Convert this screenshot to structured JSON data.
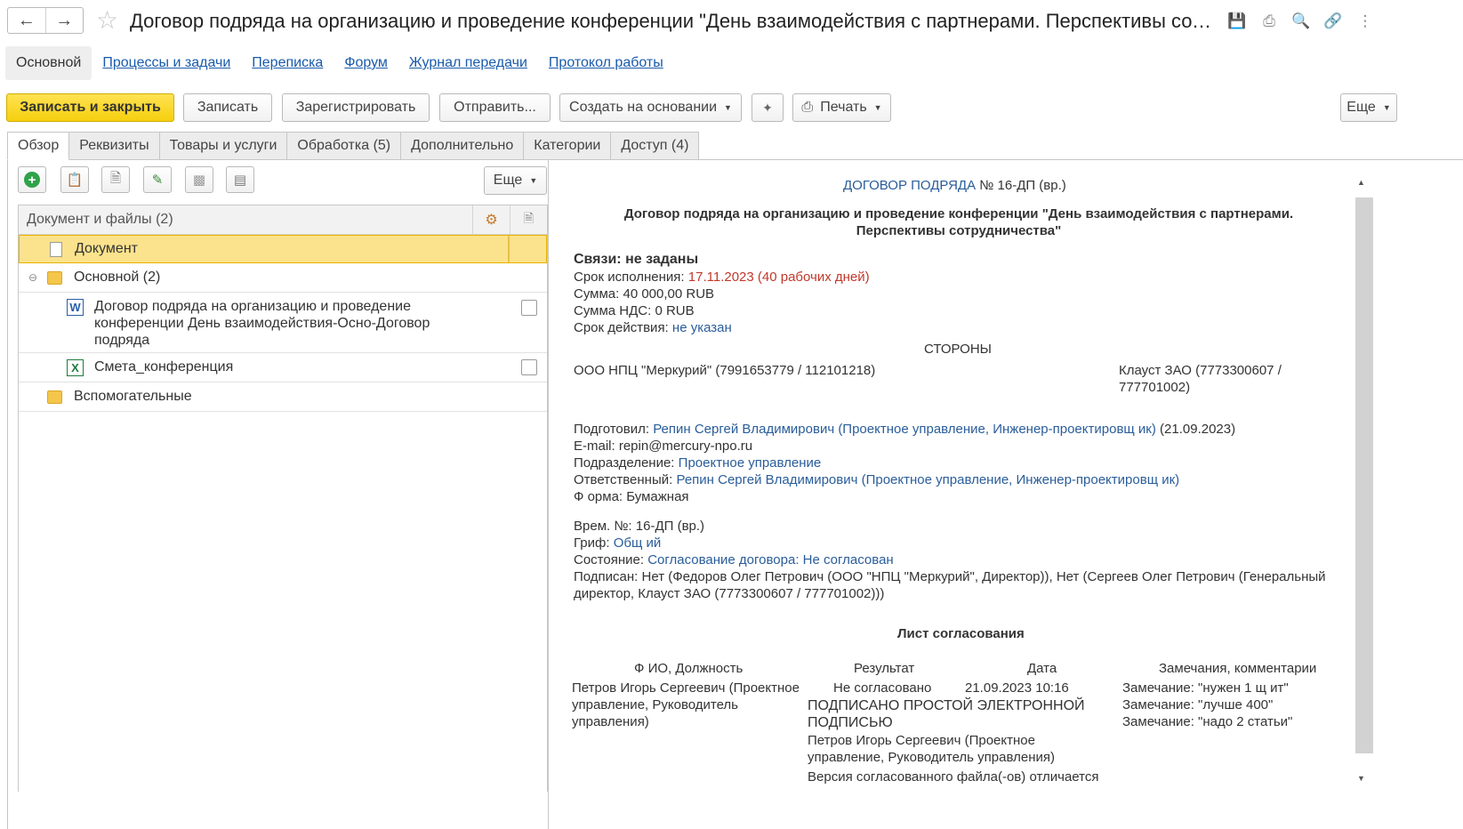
{
  "window": {
    "title": "Договор подряда на организацию и проведение конференции \"День взаимодействия с партнерами. Перспективы сотрудничества\"",
    "icons": [
      "save-icon",
      "print-icon",
      "preview-icon",
      "link-icon",
      "more-vert-icon"
    ]
  },
  "sections": [
    "Основной",
    "Процессы и задачи",
    "Переписка",
    "Форум",
    "Журнал передачи",
    "Протокол работы"
  ],
  "toolbar": {
    "save_close": "Записать и закрыть",
    "save": "Записать",
    "register": "Зарегистрировать",
    "send": "Отправить...",
    "create_based": "Создать на основании",
    "print": "Печать",
    "more": "Еще"
  },
  "tabs": [
    "Обзор",
    "Реквизиты",
    "Товары и услуги",
    "Обработка (5)",
    "Дополнительно",
    "Категории",
    "Доступ (4)"
  ],
  "left": {
    "more": "Еще",
    "tree_header": "Документ и файлы (2)",
    "items": {
      "document": "Документ",
      "main_folder": "Основной (2)",
      "file1": "Договор подряда на организацию и проведение конференции  День взаимодействия-Осно-Договор подряда",
      "file2": "Смета_конференция",
      "aux_folder": "Вспомогательные"
    }
  },
  "doc": {
    "head_link": "ДОГОВОР ПОДРЯДА",
    "head_num": "№ 16-ДП (вр.)",
    "title1": "Договор подряда на организацию и проведение конференции \"День взаимодействия с партнерами.",
    "title2": "Перспективы сотрудничества\"",
    "links": "Связи: не заданы",
    "deadline_label": "Срок исполнения:",
    "deadline_value": "17.11.2023 (40 рабочих дней)",
    "sum_label": "Сумма:",
    "sum_value": "40 000,00 RUB",
    "vat_label": "Сумма НДС:",
    "vat_value": "0 RUB",
    "validity_label": "Срок действия:",
    "validity_value": "не указан",
    "parties_heading": "СТОРОНЫ",
    "party1": "ООО НПЦ \"Меркурий\" (7991653779 / 112101218)",
    "party2a": "Клауст ЗАО (7773300607 /",
    "party2b": "777701002)",
    "prepared_label": "Подготовил:",
    "prepared_value": "Репин Сергей Владимирович (Проектное управление, Инженер-проектировщ ик)",
    "prepared_date": "(21.09.2023)",
    "email": "E-mail: repin@mercury-npo.ru",
    "dept_label": "Подразделение:",
    "dept_value": "Проектное управление",
    "resp_label": "Ответственный:",
    "resp_value": "Репин Сергей Владимирович (Проектное управление, Инженер-проектировщ ик)",
    "form_label": "Ф орма:",
    "form_value": "Бумажная",
    "tempnum_label": "Врем. №:",
    "tempnum_value": "16-ДП (вр.)",
    "grif_label": "Гриф:",
    "grif_value": "Общ ий",
    "state_label": "Состояние:",
    "state_value": "Согласование договора: Не согласован",
    "signed_label": "Подписан:",
    "signed_line1": "Нет (Федоров Олег Петрович (ООО \"НПЦ \"Меркурий\", Директор)), Нет (Сергеев Олег Петрович (Генеральный",
    "signed_line2": "директор, Клауст ЗАО (7773300607 / 777701002)))",
    "approval_heading": "Лист согласования",
    "col_fio": "Ф ИО, Должность",
    "col_result": "Результат",
    "col_date": "Дата",
    "col_comments": "Замечания, комментарии",
    "row_person1": "Петров Игорь Сергеевич (Проектное",
    "row_person2": "управление, Руководитель",
    "row_person3": "управления)",
    "row_result": "Не согласовано",
    "row_date": "21.09.2023 10:16",
    "row_comment1": "Замечание: \"нужен 1 щ ит\"",
    "row_comment2": "Замечание: \"лучше 400\"",
    "row_comment3": "Замечание: \"надо 2 статьи\"",
    "signed_simple1": "ПОДПИСАНО ПРОСТОЙ ЭЛЕКТРОННОЙ",
    "signed_simple2": "ПОДПИСЬЮ",
    "signer1": "Петров Игорь Сергеевич (Проектное",
    "signer2": "управление, Руководитель управления)",
    "version_warn": "Версия согласованного файла(-ов) отличается"
  }
}
